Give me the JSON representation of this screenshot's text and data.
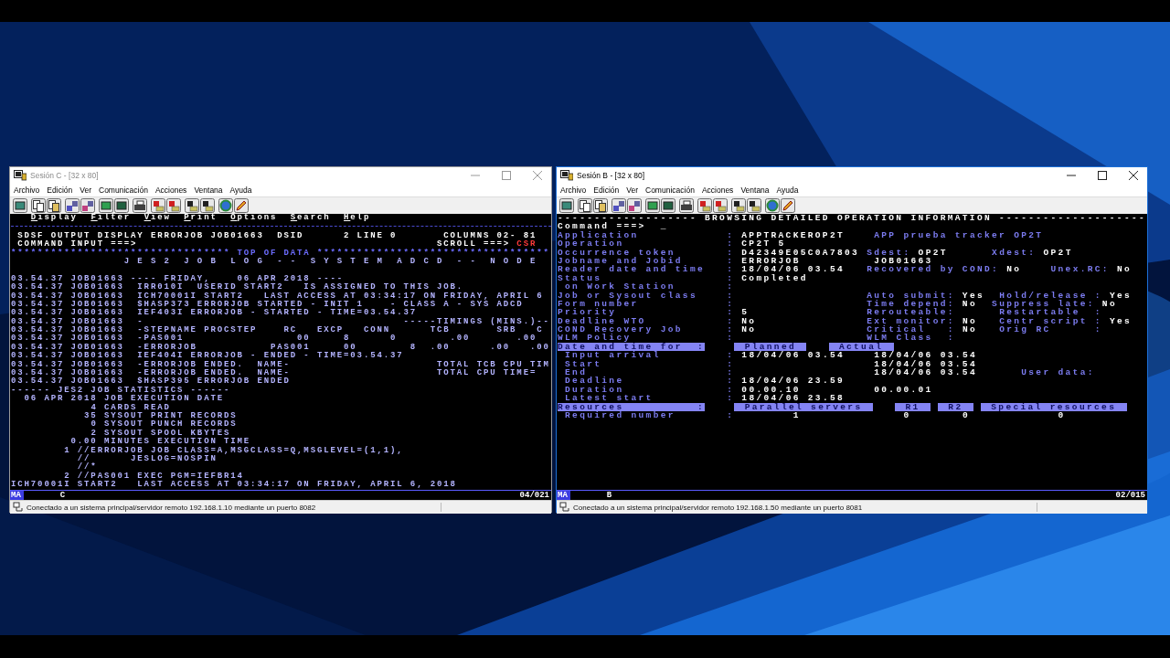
{
  "windows": [
    {
      "title": "Sesión C - [32 x 80]",
      "active": false,
      "menu": [
        "Archivo",
        "Edición",
        "Ver",
        "Comunicación",
        "Acciones",
        "Ventana",
        "Ayuda"
      ],
      "terminal": {
        "lines": [
          {
            "kind": "text",
            "segments": [
              {
                "text": "   Display",
                "kind": "menu"
              },
              {
                "text": "  Filter",
                "kind": "menu"
              },
              {
                "text": "  View",
                "kind": "menu"
              },
              {
                "text": "  Print",
                "kind": "menu"
              },
              {
                "text": "  Options",
                "kind": "menu"
              },
              {
                "text": "  Search",
                "kind": "menu"
              },
              {
                "text": "  Help",
                "kind": "menu"
              }
            ]
          },
          {
            "kind": "rule"
          },
          {
            "kind": "text",
            "segments": [
              {
                "text": " SDSF OUTPUT DISPLAY ERRORJOB JOB01663  DSID",
                "kind": "heading"
              },
              {
                "text": "      2 LINE 0",
                "kind": "heading"
              },
              {
                "text": "       COLUMNS 02- 81",
                "kind": "heading"
              }
            ]
          },
          {
            "kind": "text",
            "segments": [
              {
                "text": " COMMAND INPUT ===>",
                "kind": "prompt"
              },
              {
                "text": "                                             SCROLL ===>",
                "kind": "heading"
              },
              {
                "text": " CSR",
                "kind": "alert"
              }
            ]
          },
          {
            "kind": "text",
            "segments": [
              {
                "text": "********************************* TOP OF DATA ***********************************",
                "kind": "stars"
              }
            ]
          },
          {
            "kind": "text",
            "segments": [
              {
                "text": "                 J E S 2  J O B  L O G  - -  S Y S T E M  A D C D  - -  N O D E",
                "kind": "banner"
              }
            ]
          },
          {
            "kind": "blank"
          },
          {
            "kind": "text",
            "segments": [
              {
                "text": "03.54.37 JOB01663 ---- FRIDAY,    06 APR 2018 ----",
                "kind": "log"
              }
            ]
          },
          {
            "kind": "text",
            "segments": [
              {
                "text": "03.54.37 JOB01663  IRR010I  USERID START2   IS ASSIGNED TO THIS JOB.",
                "kind": "log"
              }
            ]
          },
          {
            "kind": "text",
            "segments": [
              {
                "text": "03.54.37 JOB01663  ICH70001I START2   LAST ACCESS AT 03:34:17 ON FRIDAY, APRIL 6",
                "kind": "log"
              }
            ]
          },
          {
            "kind": "text",
            "segments": [
              {
                "text": "03.54.37 JOB01663  $HASP373 ERRORJOB STARTED - INIT 1    - CLASS A - SYS ADCD",
                "kind": "log"
              }
            ]
          },
          {
            "kind": "text",
            "segments": [
              {
                "text": "03.54.37 JOB01663  IEF403I ERRORJOB - STARTED - TIME=03.54.37",
                "kind": "log"
              }
            ]
          },
          {
            "kind": "text",
            "segments": [
              {
                "text": "03.54.37 JOB01663  -                                       -----TIMINGS (MINS.)--",
                "kind": "log"
              }
            ]
          },
          {
            "kind": "text",
            "segments": [
              {
                "text": "03.54.37 JOB01663  -STEPNAME PROCSTEP    RC   EXCP   CONN      TCB       SRB   C",
                "kind": "log"
              }
            ]
          },
          {
            "kind": "text",
            "segments": [
              {
                "text": "03.54.37 JOB01663  -PAS001                 00     8      0        .00       .00",
                "kind": "log"
              }
            ]
          },
          {
            "kind": "text",
            "segments": [
              {
                "text": "03.54.37 JOB01663  -ERRORJOB           PAS001     00        8  .00      .00   .00",
                "kind": "log"
              }
            ]
          },
          {
            "kind": "text",
            "segments": [
              {
                "text": "03.54.37 JOB01663  IEF404I ERRORJOB - ENDED - TIME=03.54.37",
                "kind": "log"
              }
            ]
          },
          {
            "kind": "text",
            "segments": [
              {
                "text": "03.54.37 JOB01663  -ERRORJOB ENDED.  NAME-                      TOTAL TCB CPU TIM",
                "kind": "log"
              }
            ]
          },
          {
            "kind": "text",
            "segments": [
              {
                "text": "03.54.37 JOB01663  -ERRORJOB ENDED.  NAME-                      TOTAL CPU TIME=",
                "kind": "log"
              }
            ]
          },
          {
            "kind": "text",
            "segments": [
              {
                "text": "03.54.37 JOB01663  $HASP395 ERRORJOB ENDED",
                "kind": "log"
              }
            ]
          },
          {
            "kind": "text",
            "segments": [
              {
                "text": "------ JES2 JOB STATISTICS ------",
                "kind": "log"
              }
            ]
          },
          {
            "kind": "text",
            "segments": [
              {
                "text": "  06 APR 2018 JOB EXECUTION DATE",
                "kind": "log"
              }
            ]
          },
          {
            "kind": "text",
            "segments": [
              {
                "text": "            4 CARDS READ",
                "kind": "log"
              }
            ]
          },
          {
            "kind": "text",
            "segments": [
              {
                "text": "           35 SYSOUT PRINT RECORDS",
                "kind": "log"
              }
            ]
          },
          {
            "kind": "text",
            "segments": [
              {
                "text": "            0 SYSOUT PUNCH RECORDS",
                "kind": "log"
              }
            ]
          },
          {
            "kind": "text",
            "segments": [
              {
                "text": "            2 SYSOUT SPOOL KBYTES",
                "kind": "log"
              }
            ]
          },
          {
            "kind": "text",
            "segments": [
              {
                "text": "         0.00 MINUTES EXECUTION TIME",
                "kind": "log"
              }
            ]
          },
          {
            "kind": "text",
            "segments": [
              {
                "text": "        1 //ERRORJOB JOB CLASS=A,MSGCLASS=Q,MSGLEVEL=(1,1),",
                "kind": "log"
              }
            ]
          },
          {
            "kind": "text",
            "segments": [
              {
                "text": "          //      JESLOG=NOSPIN",
                "kind": "log"
              }
            ]
          },
          {
            "kind": "text",
            "segments": [
              {
                "text": "          //*",
                "kind": "log"
              }
            ]
          },
          {
            "kind": "text",
            "segments": [
              {
                "text": "        2 //PAS001 EXEC PGM=IEFBR14",
                "kind": "log"
              }
            ]
          },
          {
            "kind": "text",
            "segments": [
              {
                "text": "ICH70001I START2   LAST ACCESS AT 03:34:17 ON FRIDAY, APRIL 6, 2018",
                "kind": "log"
              }
            ]
          }
        ]
      },
      "oia": {
        "mode": "MA",
        "session": "C",
        "cursor": "04/021"
      },
      "status": "Conectado a un sistema principal/servidor remoto 192.168.1.10 mediante un puerto 8082"
    },
    {
      "title": "Sesión B - [32 x 80]",
      "active": true,
      "menu": [
        "Archivo",
        "Edición",
        "Ver",
        "Comunicación",
        "Acciones",
        "Ventana",
        "Ayuda"
      ],
      "terminal": {
        "lines": [
          {
            "kind": "text",
            "segments": [
              {
                "text": "------------------- BROWSING DETAILED OPERATION INFORMATION --------------------",
                "kind": "title"
              }
            ]
          },
          {
            "kind": "text",
            "segments": [
              {
                "text": "Command ===>",
                "kind": "prompt"
              },
              {
                "text": "  _",
                "kind": "cursor"
              }
            ]
          },
          {
            "kind": "text",
            "segments": [
              {
                "text": "Application",
                "kind": "label"
              },
              {
                "text": "            :",
                "kind": "label"
              },
              {
                "text": " APPTRACKEROP2T",
                "kind": "value"
              },
              {
                "text": "    APP prueba tracker OP2T",
                "kind": "label"
              }
            ]
          },
          {
            "kind": "text",
            "segments": [
              {
                "text": "Operation",
                "kind": "label"
              },
              {
                "text": "              :",
                "kind": "label"
              },
              {
                "text": " CP2T 5",
                "kind": "value"
              }
            ]
          },
          {
            "kind": "text",
            "segments": [
              {
                "text": "Occurrence token",
                "kind": "label"
              },
              {
                "text": "       :",
                "kind": "label"
              },
              {
                "text": " D42349E05C0A7803",
                "kind": "value"
              },
              {
                "text": " Sdest:",
                "kind": "label"
              },
              {
                "text": " OP2T",
                "kind": "value"
              },
              {
                "text": "      Xdest:",
                "kind": "label"
              },
              {
                "text": " OP2T",
                "kind": "value"
              }
            ]
          },
          {
            "kind": "text",
            "segments": [
              {
                "text": "Jobname and Jobid",
                "kind": "label"
              },
              {
                "text": "      :",
                "kind": "label"
              },
              {
                "text": " ERRORJOB",
                "kind": "value"
              },
              {
                "text": "          JOB01663",
                "kind": "value"
              }
            ]
          },
          {
            "kind": "text",
            "segments": [
              {
                "text": "Reader date and time",
                "kind": "label"
              },
              {
                "text": "   :",
                "kind": "label"
              },
              {
                "text": " 18/04/06 03.54",
                "kind": "value"
              },
              {
                "text": "   Recovered by COND:",
                "kind": "label"
              },
              {
                "text": " No",
                "kind": "value"
              },
              {
                "text": "    Unex.RC:",
                "kind": "label"
              },
              {
                "text": " No",
                "kind": "value"
              }
            ]
          },
          {
            "kind": "text",
            "segments": [
              {
                "text": "Status",
                "kind": "label"
              },
              {
                "text": "                 :",
                "kind": "label"
              },
              {
                "text": " Completed",
                "kind": "value"
              }
            ]
          },
          {
            "kind": "text",
            "segments": [
              {
                "text": " on Work Station",
                "kind": "label"
              },
              {
                "text": "       :",
                "kind": "label"
              }
            ]
          },
          {
            "kind": "text",
            "segments": [
              {
                "text": "Job or Sysout class",
                "kind": "label"
              },
              {
                "text": "    :",
                "kind": "label"
              },
              {
                "text": "                  Auto submit:",
                "kind": "label"
              },
              {
                "text": " Yes",
                "kind": "value"
              },
              {
                "text": "  Hold/release :",
                "kind": "label"
              },
              {
                "text": " Yes",
                "kind": "value"
              }
            ]
          },
          {
            "kind": "text",
            "segments": [
              {
                "text": "Form number",
                "kind": "label"
              },
              {
                "text": "            :",
                "kind": "label"
              },
              {
                "text": "                  Time depend:",
                "kind": "label"
              },
              {
                "text": " No",
                "kind": "value"
              },
              {
                "text": "  Suppress late:",
                "kind": "label"
              },
              {
                "text": " No",
                "kind": "value"
              }
            ]
          },
          {
            "kind": "text",
            "segments": [
              {
                "text": "Priority",
                "kind": "label"
              },
              {
                "text": "               :",
                "kind": "label"
              },
              {
                "text": " 5",
                "kind": "value"
              },
              {
                "text": "                Rerouteable:",
                "kind": "label"
              },
              {
                "text": "      Restartable  :",
                "kind": "label"
              }
            ]
          },
          {
            "kind": "text",
            "segments": [
              {
                "text": "Deadline WTO",
                "kind": "label"
              },
              {
                "text": "           :",
                "kind": "label"
              },
              {
                "text": " No",
                "kind": "value"
              },
              {
                "text": "               Ext monitor:",
                "kind": "label"
              },
              {
                "text": " No",
                "kind": "value"
              },
              {
                "text": "   Centr script :",
                "kind": "label"
              },
              {
                "text": " Yes",
                "kind": "value"
              }
            ]
          },
          {
            "kind": "text",
            "segments": [
              {
                "text": "COND Recovery Job",
                "kind": "label"
              },
              {
                "text": "      :",
                "kind": "label"
              },
              {
                "text": " No",
                "kind": "value"
              },
              {
                "text": "               Critical   :",
                "kind": "label"
              },
              {
                "text": " No",
                "kind": "value"
              },
              {
                "text": "   Orig RC      :",
                "kind": "label"
              }
            ]
          },
          {
            "kind": "text",
            "segments": [
              {
                "text": "WLM Policy",
                "kind": "label"
              },
              {
                "text": "             :",
                "kind": "label"
              },
              {
                "text": "                  WLM Class  :",
                "kind": "label"
              }
            ]
          },
          {
            "kind": "text",
            "segments": [
              {
                "text": "Date and time for  :",
                "kind": "header"
              },
              {
                "text": "    Planned",
                "kind": "tag"
              },
              {
                "text": "   Actual",
                "kind": "tag"
              }
            ]
          },
          {
            "kind": "text",
            "segments": [
              {
                "text": " Input arrival",
                "kind": "label"
              },
              {
                "text": "         :",
                "kind": "label"
              },
              {
                "text": " 18/04/06 03.54",
                "kind": "value"
              },
              {
                "text": "    18/04/06 03.54",
                "kind": "value"
              }
            ]
          },
          {
            "kind": "text",
            "segments": [
              {
                "text": " Start",
                "kind": "label"
              },
              {
                "text": "                 :",
                "kind": "label"
              },
              {
                "text": "                   18/04/06 03.54",
                "kind": "value"
              }
            ]
          },
          {
            "kind": "text",
            "segments": [
              {
                "text": " End",
                "kind": "label"
              },
              {
                "text": "                   :",
                "kind": "label"
              },
              {
                "text": "                   18/04/06 03.54",
                "kind": "value"
              },
              {
                "text": "      User data:",
                "kind": "label"
              }
            ]
          },
          {
            "kind": "text",
            "segments": [
              {
                "text": " Deadline",
                "kind": "label"
              },
              {
                "text": "              :",
                "kind": "label"
              },
              {
                "text": " 18/04/06 23.59",
                "kind": "value"
              }
            ]
          },
          {
            "kind": "text",
            "segments": [
              {
                "text": " Duration",
                "kind": "label"
              },
              {
                "text": "              :",
                "kind": "label"
              },
              {
                "text": " 00.00.10",
                "kind": "value"
              },
              {
                "text": "          00.00.01",
                "kind": "value"
              }
            ]
          },
          {
            "kind": "text",
            "segments": [
              {
                "text": " Latest start",
                "kind": "label"
              },
              {
                "text": "          :",
                "kind": "label"
              },
              {
                "text": " 18/04/06 23.58",
                "kind": "value"
              }
            ]
          },
          {
            "kind": "text",
            "segments": [
              {
                "text": "Resources          :",
                "kind": "header"
              },
              {
                "text": "    Parallel servers",
                "kind": "tag"
              },
              {
                "text": "   R1",
                "kind": "tag"
              },
              {
                "text": " R2",
                "kind": "tag"
              },
              {
                "text": " Special resources",
                "kind": "tag"
              }
            ]
          },
          {
            "kind": "text",
            "segments": [
              {
                "text": " Required number",
                "kind": "label"
              },
              {
                "text": "       :",
                "kind": "label"
              },
              {
                "text": "        1",
                "kind": "value"
              },
              {
                "text": "              0",
                "kind": "value"
              },
              {
                "text": "       0",
                "kind": "value"
              },
              {
                "text": "            0",
                "kind": "value"
              }
            ]
          }
        ]
      },
      "oia": {
        "mode": "MA",
        "session": "B",
        "cursor": "02/015"
      },
      "status": "Conectado a un sistema principal/servidor remoto 192.168.1.50 mediante un puerto 8081"
    }
  ]
}
